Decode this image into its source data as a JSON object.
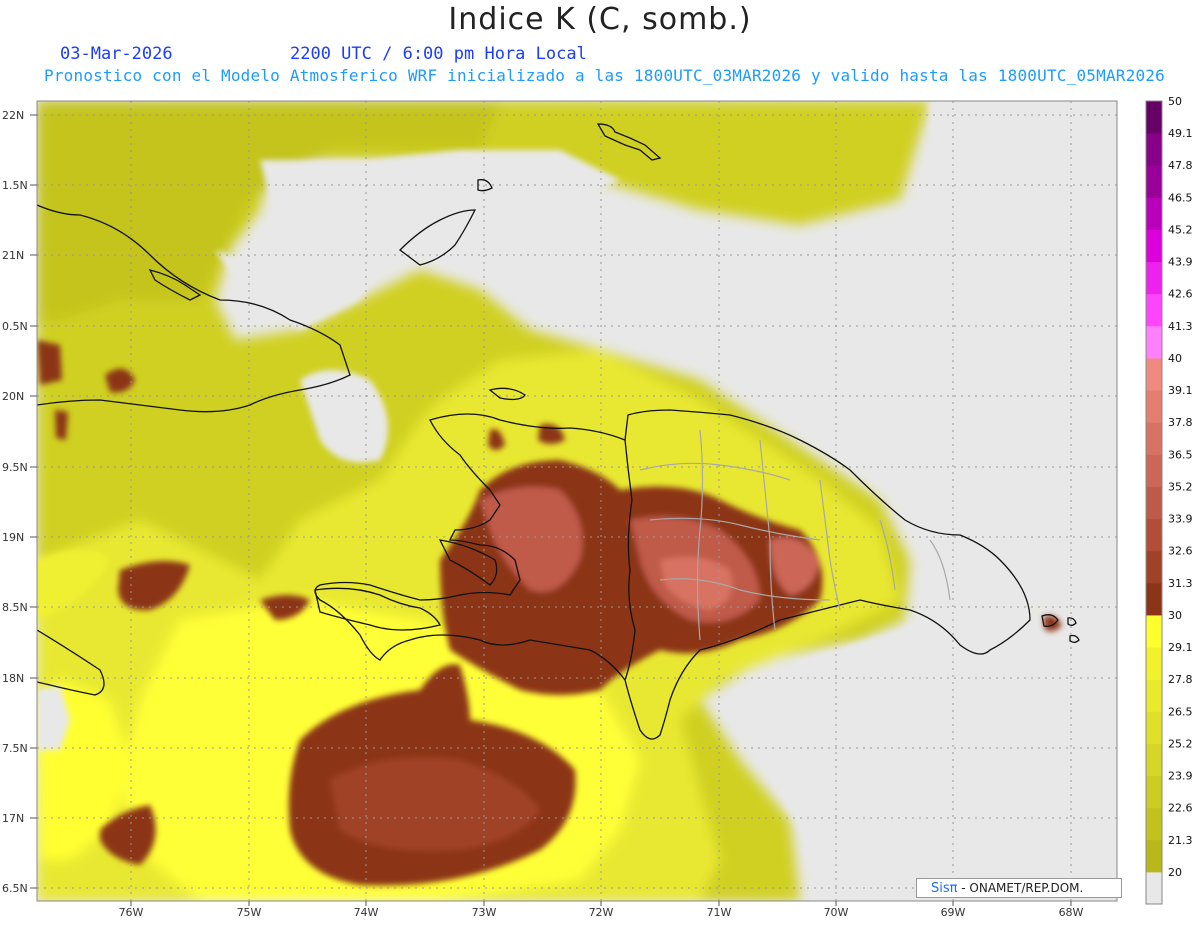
{
  "header": {
    "title": "Indice K (C, somb.)",
    "date": "03-Mar-2026",
    "time": "2200 UTC / 6:00 pm Hora Local",
    "subtitle": "Pronostico con el Modelo Atmosferico WRF inicializado a las 1800UTC_03MAR2026 y valido hasta las  1800UTC_05MAR2026"
  },
  "axes": {
    "lat_labels": [
      "22N",
      "1.5N",
      "21N",
      "0.5N",
      "20N",
      "9.5N",
      "19N",
      "8.5N",
      "18N",
      "7.5N",
      "17N",
      "6.5N"
    ],
    "lon_labels": [
      "76W",
      "75W",
      "74W",
      "73W",
      "72W",
      "71W",
      "70W",
      "69W",
      "68W"
    ]
  },
  "colorbar": {
    "levels": [
      "20",
      "21.3",
      "22.6",
      "23.9",
      "25.2",
      "26.5",
      "27.8",
      "29.1",
      "30",
      "31.3",
      "32.6",
      "33.9",
      "35.2",
      "36.5",
      "37.8",
      "39.1",
      "40",
      "41.3",
      "42.6",
      "43.9",
      "45.2",
      "46.5",
      "47.8",
      "49.1",
      "50"
    ],
    "colors": [
      "#b8b81a",
      "#c2c21c",
      "#cccc22",
      "#d6d628",
      "#e0e02a",
      "#eaea2c",
      "#f2f22c",
      "#ffff30",
      "#8c3418",
      "#a04228",
      "#b24e38",
      "#c05a48",
      "#cc6656",
      "#d87262",
      "#e47e6e",
      "#f08a80",
      "#ff80ff",
      "#ff44ff",
      "#ee22ee",
      "#dd00dd",
      "#bb00bb",
      "#990099",
      "#880088",
      "#660066"
    ]
  },
  "credit": {
    "logo": "Sisπ",
    "text": " - ONAMET/REP.DOM."
  }
}
